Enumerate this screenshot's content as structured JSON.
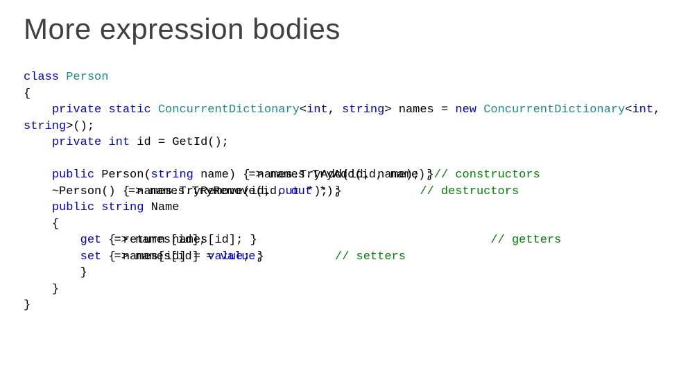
{
  "title": "More expression bodies",
  "code": {
    "kw_class": "class",
    "typ_person": "Person",
    "brace_open": "{",
    "indent1": "    ",
    "indent2": "        ",
    "kw_private": "private",
    "kw_static": "static",
    "typ_cd": "ConcurrentDictionary",
    "lt": "<",
    "kw_int": "int",
    "comma_sp": ", ",
    "kw_string": "string",
    "gt_sp_names_eq": "> names = ",
    "kw_new": "new",
    "gt_paren_semi": ">();",
    "sp_id_eq_getid": " id = GetId();",
    "kw_public": "public",
    "sp_person_paren": " Person(",
    "sp_name_rparen": " name) ",
    "ctor_a": "{ names.TryAdd(id, name); }",
    "ctor_b": "=> names.TryAdd(id, name);",
    "cmt_ctors": "// constructors",
    "dtor_pre": "~Person() ",
    "dtor_a": "{ names.TryRemove(id, ",
    "dtor_b": "=> names.TryRemove(id, ",
    "kw_out": "out",
    "dtor_a_tail": " *); }",
    "dtor_b_tail": " *);",
    "dtor_pad": "           ",
    "cmt_dtors": "// destructors",
    "sp_space": " ",
    "sp_name": " Name",
    "kw_get": "get",
    "get_a": "{ return names[id]; }",
    "get_b": "=> names[id];",
    "get_pad": "                                 ",
    "cmt_getters": "// getters",
    "kw_set": "set",
    "set_a": "{ names[id] = ",
    "set_b": "=> names[id] = ",
    "kw_value": "value",
    "set_a_tail": "; }",
    "set_b_tail": ";",
    "set_pad": "          ",
    "cmt_setters": "// setters",
    "brace_close": "}"
  }
}
